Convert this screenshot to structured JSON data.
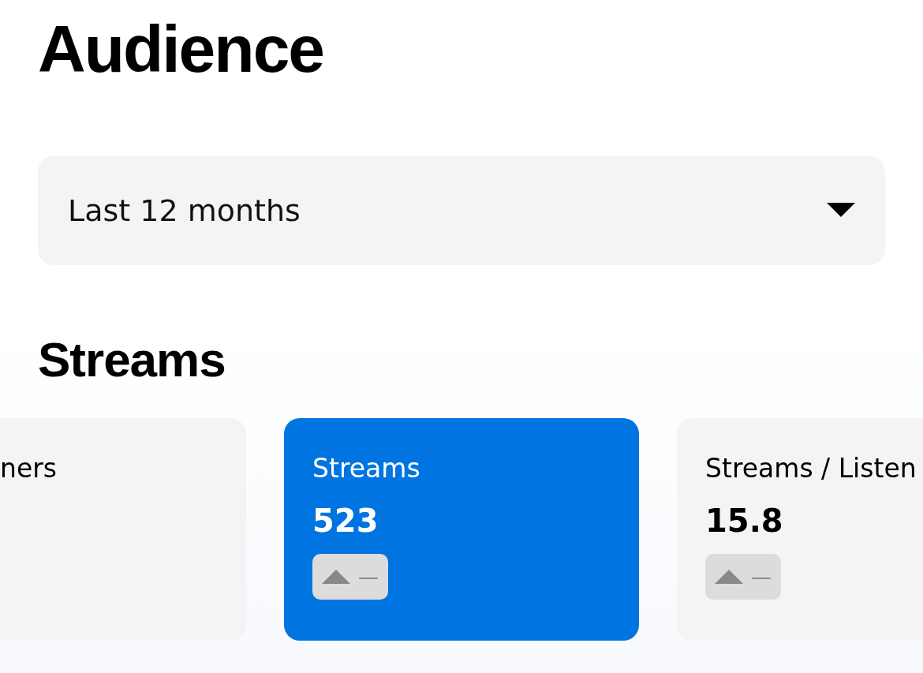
{
  "title": "Audience",
  "period_select": {
    "value": "Last 12 months"
  },
  "section_title": "Streams",
  "cards": [
    {
      "label": "ners",
      "selected": false,
      "clipped": true
    },
    {
      "label": "Streams",
      "value": "523",
      "selected": true,
      "change": "—"
    },
    {
      "label": "Streams / Listen",
      "value": "15.8",
      "selected": false,
      "change": "—"
    }
  ]
}
